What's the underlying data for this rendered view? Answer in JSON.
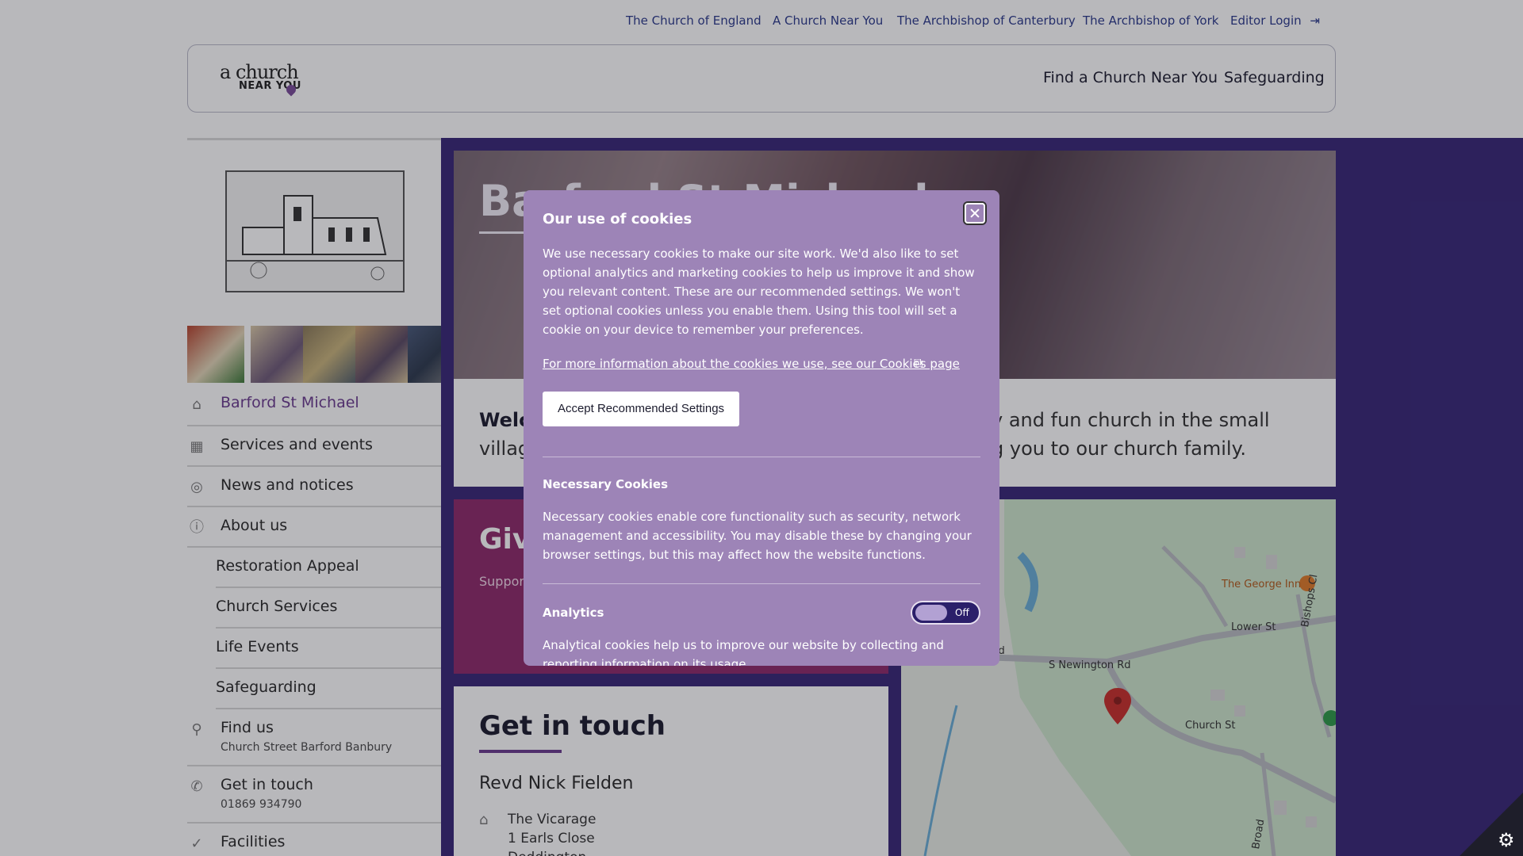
{
  "top_nav": {
    "links": [
      "The Church of England",
      "A Church Near You",
      "The Archbishop of Canterbury",
      "The Archbishop of York"
    ],
    "editor_login": "Editor Login"
  },
  "header": {
    "logo_line1": "a church",
    "logo_line2": "NEAR YOU",
    "nav": [
      "Find a Church Near You",
      "Safeguarding"
    ]
  },
  "sidebar": {
    "items": [
      {
        "label": "Barford St Michael",
        "icon": "home-icon",
        "active": true
      },
      {
        "label": "Services and events",
        "icon": "calendar-icon"
      },
      {
        "label": "News and notices",
        "icon": "broadcast-icon"
      },
      {
        "label": "About us",
        "icon": "info-icon"
      }
    ],
    "sub_items": [
      "Restoration Appeal",
      "Church Services",
      "Life Events",
      "Safeguarding"
    ],
    "find_us": {
      "label": "Find us",
      "detail": "Church Street Barford Banbury"
    },
    "get_in_touch": {
      "label": "Get in touch",
      "detail": "01869 934790"
    },
    "facilities": {
      "label": "Facilities"
    }
  },
  "hero": {
    "title": "Barford St Michael"
  },
  "welcome": {
    "text_left_line1": "Welc",
    "text_left_line2": "villag",
    "text_right_line1": "y and fun church in the small",
    "text_right_line2": "g you to our church family."
  },
  "give": {
    "title": "Give",
    "subtitle": "Suppor"
  },
  "contact": {
    "title": "Get in touch",
    "name": "Revd Nick Fielden",
    "address": [
      "The Vicarage",
      "1 Earls Close",
      "Deddington"
    ]
  },
  "map": {
    "labels": [
      "The George Inn",
      "Lower St",
      "S Newington Rd",
      "ton Rd",
      "Church St",
      "Bishops Cl",
      "Broad"
    ]
  },
  "cookie_modal": {
    "title": "Our use of cookies",
    "intro": "We use necessary cookies to make our site work. We'd also like to set optional analytics and marketing cookies to help us improve it and show you relevant content. These are our recommended settings. We won't set optional cookies unless you enable them. Using this tool will set a cookie on your device to remember your preferences.",
    "more_info_link": "For more information about the cookies we use, see our Cookies page",
    "accept_button": "Accept Recommended Settings",
    "necessary_title": "Necessary Cookies",
    "necessary_text": "Necessary cookies enable core functionality such as security, network management and accessibility. You may disable these by changing your browser settings, but this may affect how the website functions.",
    "analytics_title": "Analytics",
    "analytics_toggle": "Off",
    "analytics_text": "Analytical cookies help us to improve our website by collecting and reporting information on its usage."
  },
  "colors": {
    "accent_purple": "#6a3b8f",
    "band": "#382878",
    "modal": "#9d84b7",
    "give": "#8e2a6a"
  }
}
